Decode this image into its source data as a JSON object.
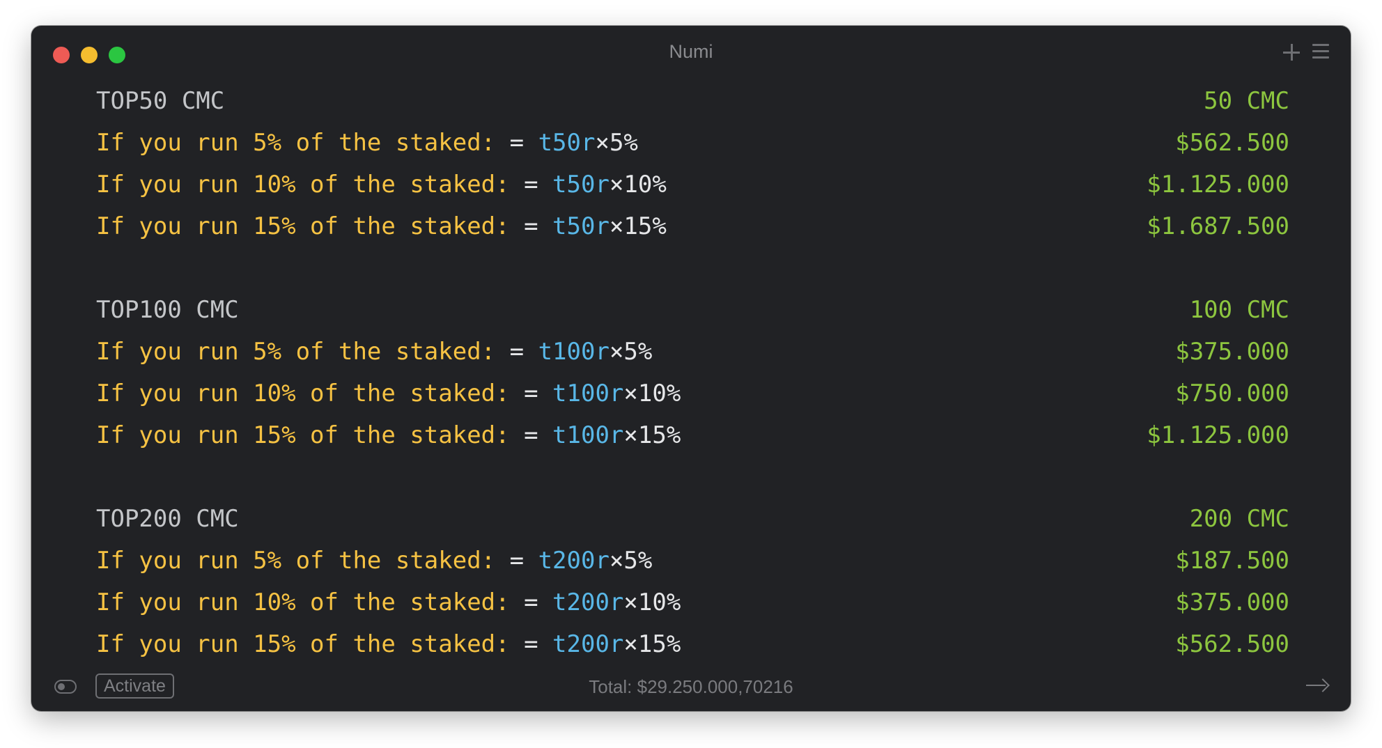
{
  "window": {
    "title": "Numi"
  },
  "lines": [
    {
      "head": "TOP50 CMC",
      "result": "50 CMC"
    },
    {
      "text": "If you run 5% of the staked: ",
      "eq": "= ",
      "var": "t50r",
      "rest": "×5%",
      "result": "$562.500"
    },
    {
      "text": "If you run 10% of the staked: ",
      "eq": "= ",
      "var": "t50r",
      "rest": "×10%",
      "result": "$1.125.000"
    },
    {
      "text": "If you run 15% of the staked: ",
      "eq": "= ",
      "var": "t50r",
      "rest": "×15%",
      "result": "$1.687.500"
    },
    {
      "head": "TOP100 CMC",
      "result": "100 CMC"
    },
    {
      "text": "If you run 5% of the staked: ",
      "eq": "= ",
      "var": "t100r",
      "rest": "×5%",
      "result": "$375.000"
    },
    {
      "text": "If you run 10% of the staked: ",
      "eq": "= ",
      "var": "t100r",
      "rest": "×10%",
      "result": "$750.000"
    },
    {
      "text": "If you run 15% of the staked: ",
      "eq": "= ",
      "var": "t100r",
      "rest": "×15%",
      "result": "$1.125.000"
    },
    {
      "head": "TOP200 CMC",
      "result": "200 CMC"
    },
    {
      "text": "If you run 5% of the staked: ",
      "eq": "= ",
      "var": "t200r",
      "rest": "×5%",
      "result": "$187.500"
    },
    {
      "text": "If you run 10% of the staked: ",
      "eq": "= ",
      "var": "t200r",
      "rest": "×10%",
      "result": "$375.000"
    },
    {
      "text": "If you run 15% of the staked: ",
      "eq": "= ",
      "var": "t200r",
      "rest": "×15%",
      "result": "$562.500"
    }
  ],
  "footer": {
    "activate_label": "Activate",
    "total": "Total: $29.250.000,70216"
  },
  "icons": {
    "toolbar": [
      "plus-icon",
      "menu-icon"
    ],
    "footer": [
      "toggle-icon",
      "arrow-right-icon"
    ]
  },
  "colors": {
    "window_bg": "#212225",
    "label_yellow": "#f6c243",
    "variable_blue": "#59b7e7",
    "result_green": "#8dc63f",
    "heading_gray": "#c4c6c9"
  }
}
